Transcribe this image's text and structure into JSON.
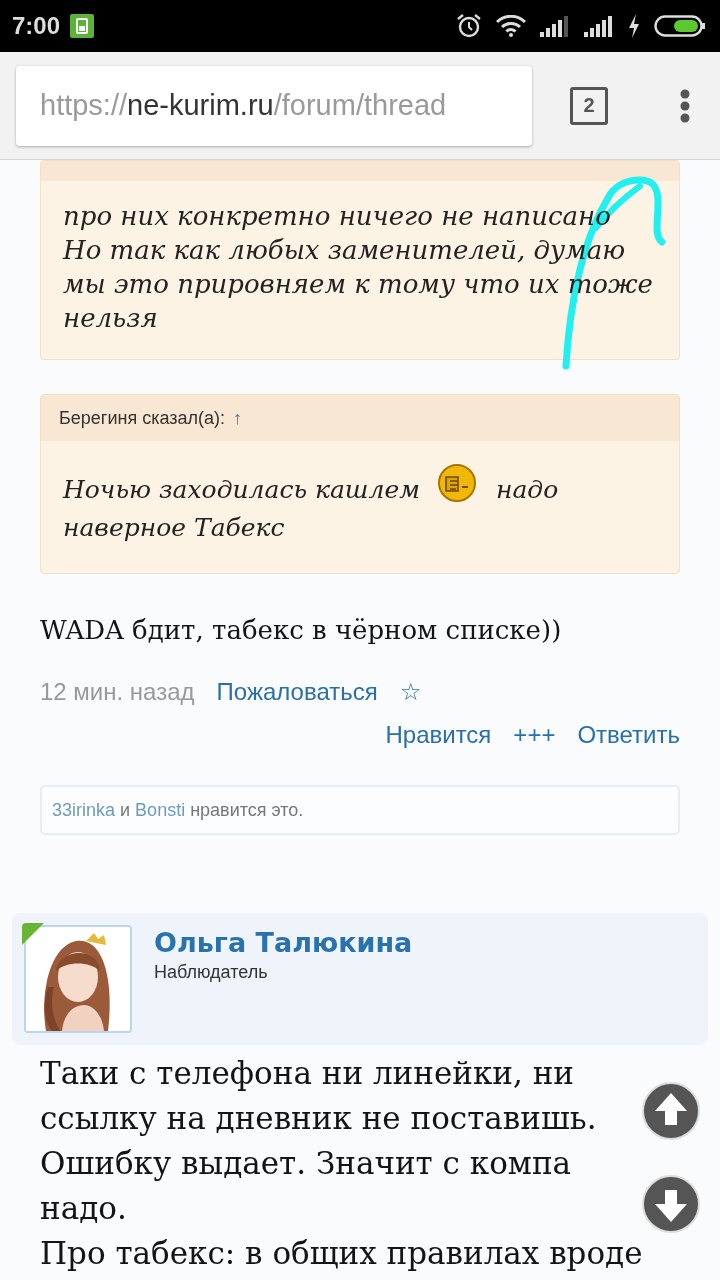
{
  "status_bar": {
    "time": "7:00"
  },
  "browser": {
    "url_scheme": "https://",
    "url_host": "ne-kurim.ru",
    "url_path": "/forum/thread",
    "tab_count": "2"
  },
  "quotes": [
    {
      "parts": [
        {
          "kind": "text",
          "text": "про них конкретно ничего не написано"
        },
        {
          "kind": "break"
        },
        {
          "kind": "text",
          "text": "Но так как любых заменителей, думаю мы это прировняем к тому что их тоже нельзя"
        }
      ]
    },
    {
      "author": "Берегиня сказал(а):",
      "jump": "↑",
      "parts": [
        {
          "kind": "text",
          "text": "Ночью заходилась кашлем"
        },
        {
          "kind": "emoji"
        },
        {
          "kind": "text",
          "text": "надо наверное Табекс"
        }
      ]
    }
  ],
  "post": {
    "text": "WADA бдит, табекс в чёрном списке))",
    "time": "12 мин. назад",
    "report": "Пожаловаться",
    "bookmark": "☆",
    "actions": [
      "Нравится",
      "+++",
      "Ответить"
    ],
    "likes": {
      "users": [
        "33irinka",
        "Bonsti"
      ],
      "joiner": "и",
      "suffix": "нравится это."
    }
  },
  "next_post": {
    "author": "Ольга Талюкина",
    "role": "Наблюдатель",
    "online": true,
    "paragraphs": [
      "Таки с телефона ни линейки, ни ссылку на дневник не поставишь. Ошибку выдает. Значит с компа надо.",
      "Про табекс: в общих правилах вроде"
    ]
  }
}
